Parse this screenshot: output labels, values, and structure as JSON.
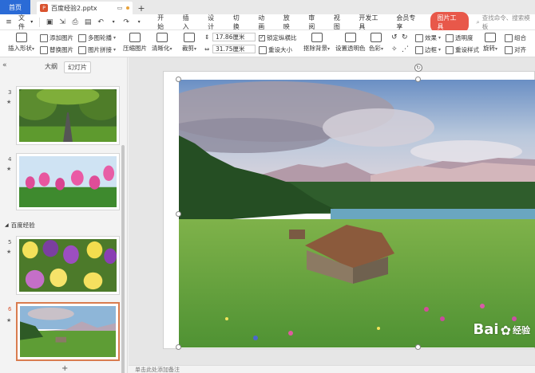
{
  "titlebar": {
    "home_label": "首页",
    "doc_title": "百度经验2.pptx",
    "ppt_badge": "P",
    "new_tab": "+"
  },
  "menubar": {
    "file_label": "文件",
    "menus": [
      "开始",
      "插入",
      "设计",
      "切换",
      "动画",
      "放映",
      "审阅",
      "视图",
      "开发工具",
      "会员专享"
    ],
    "picture_tool": "图片工具",
    "search_placeholder": "查找命令、搜索模板"
  },
  "ribbon": {
    "insert_shape": "插入形状",
    "add_picture": "添加图片",
    "multi_crop": "多图轮播",
    "replace_picture": "替换图片",
    "picture_splice": "图片拼接",
    "compress": "压缩图片",
    "sharpen": "清晰化",
    "crop": "裁剪",
    "height_value": "17.86厘米",
    "width_value": "31.75厘米",
    "lock_ratio": "锁定纵横比",
    "reset_size": "重设大小",
    "remove_bg": "抠除背景",
    "set_transparent": "设置透明色",
    "color": "色彩",
    "effects": "效果",
    "transparency": "透明度",
    "border": "边框",
    "reset_style": "重设样式",
    "rotate": "旋转",
    "combine": "组合",
    "align": "对齐"
  },
  "leftpanel": {
    "tab_outline": "大纲",
    "tab_slides": "幻灯片",
    "section_label": "百度经验",
    "slides": [
      {
        "num": "3",
        "star": "★"
      },
      {
        "num": "4",
        "star": "★"
      },
      {
        "num": "5",
        "star": "★"
      },
      {
        "num": "6",
        "star": "★"
      }
    ],
    "add_slide": "+"
  },
  "canvas": {
    "notes_placeholder": "单击此处添加备注",
    "watermark_text": "Bai",
    "watermark_suffix": "经验"
  },
  "colors": {
    "accent_blue": "#2b6bd6",
    "picture_tool_red": "#e8584a",
    "selection_orange": "#d97c4f"
  }
}
